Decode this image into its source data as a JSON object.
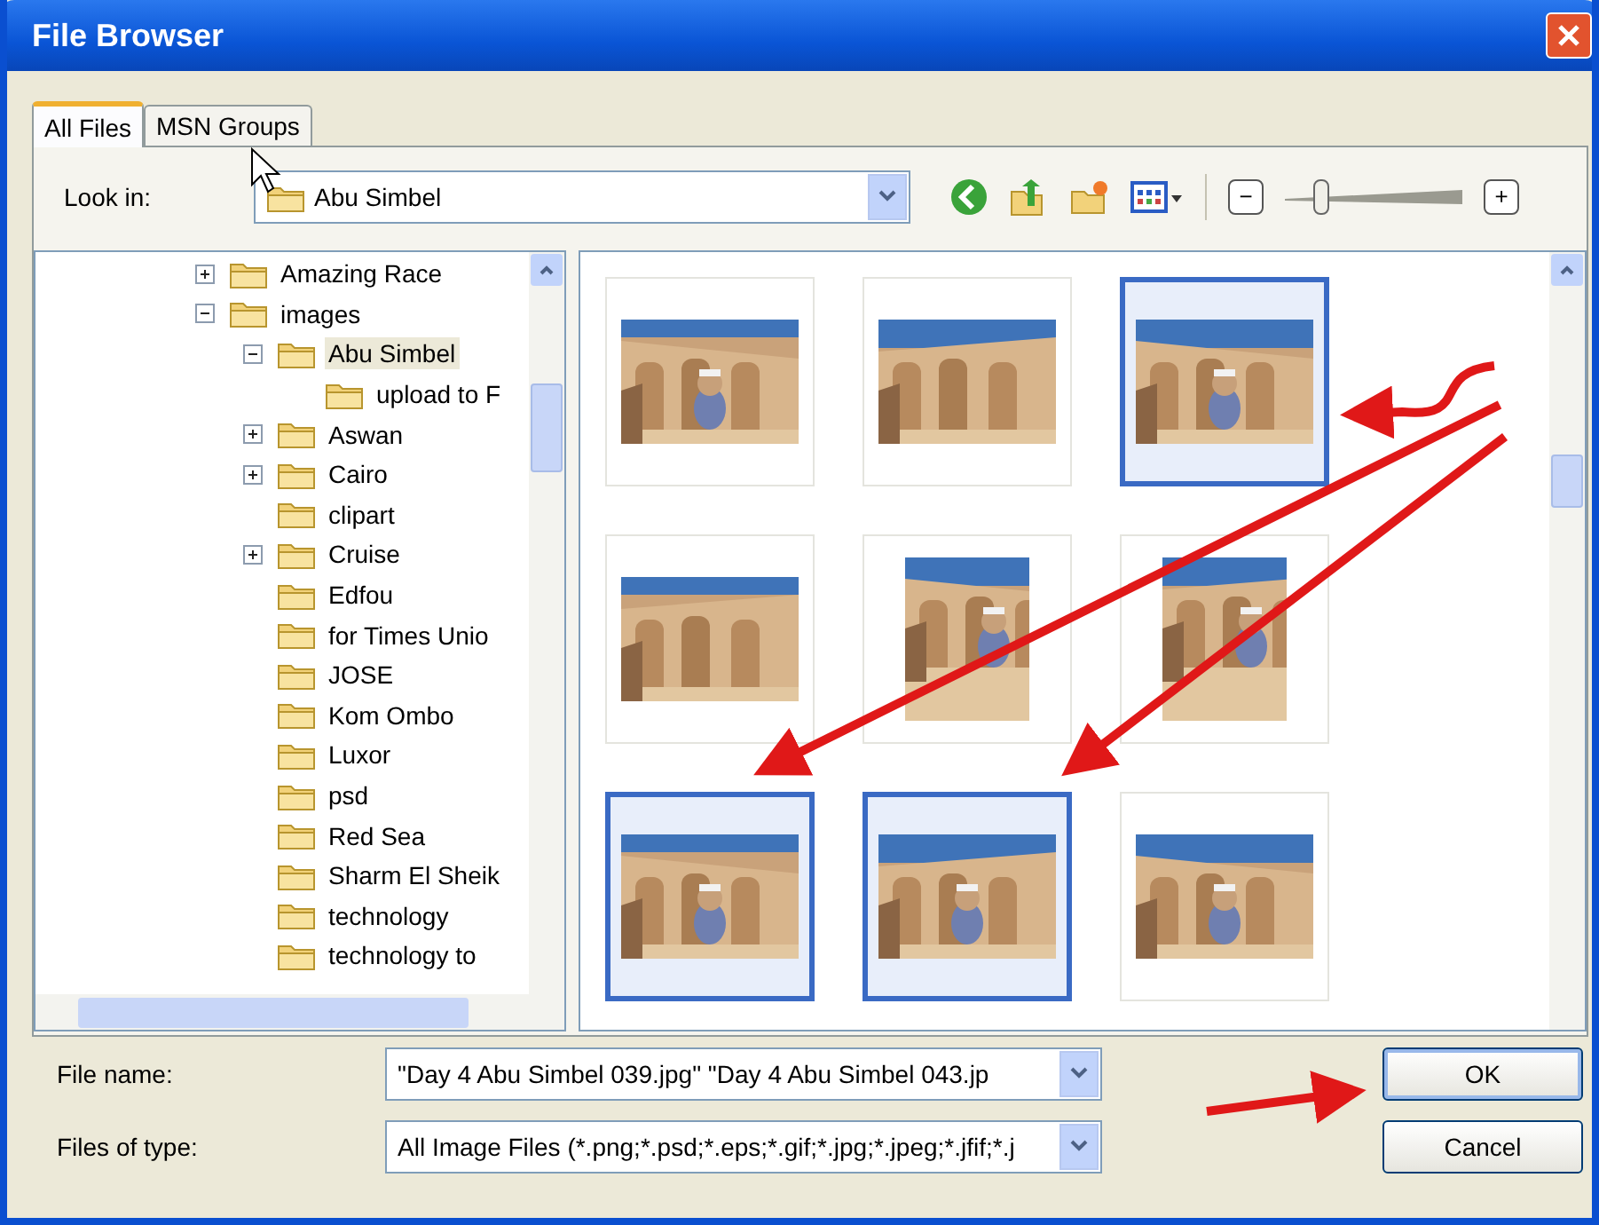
{
  "window": {
    "title": "File Browser"
  },
  "tabs": [
    {
      "label": "All Files",
      "selected": true
    },
    {
      "label": "MSN Groups",
      "selected": false
    }
  ],
  "look_in": {
    "label": "Look in:",
    "value": "Abu Simbel"
  },
  "zoom": {
    "zoom_out": "−",
    "zoom_in": "+",
    "level": 0.2
  },
  "tree": [
    {
      "label": "Amazing Race",
      "expanded": false,
      "selected": false
    },
    {
      "label": "images",
      "expanded": true,
      "selected": false,
      "children": [
        {
          "label": "Abu Simbel",
          "expanded": true,
          "selected": true,
          "children": [
            {
              "label": "upload to F",
              "selected": false
            }
          ]
        },
        {
          "label": "Aswan",
          "expanded": false,
          "selected": false
        },
        {
          "label": "Cairo",
          "expanded": false,
          "selected": false
        },
        {
          "label": "clipart",
          "selected": false
        },
        {
          "label": "Cruise",
          "expanded": false,
          "selected": false
        },
        {
          "label": "Edfou",
          "selected": false
        },
        {
          "label": "for Times Unio",
          "selected": false
        },
        {
          "label": "JOSE",
          "selected": false
        },
        {
          "label": "Kom Ombo",
          "selected": false
        },
        {
          "label": "Luxor",
          "selected": false
        },
        {
          "label": "psd",
          "selected": false
        },
        {
          "label": "Red Sea",
          "selected": false
        },
        {
          "label": "Sharm El Sheik",
          "selected": false
        },
        {
          "label": "technology",
          "selected": false
        },
        {
          "label": "technology to",
          "selected": false
        }
      ]
    }
  ],
  "thumbnails": [
    {
      "kind": "picture",
      "selected": false
    },
    {
      "kind": "picture",
      "selected": false
    },
    {
      "kind": "picture",
      "selected": true
    },
    {
      "kind": "picture",
      "selected": false
    },
    {
      "kind": "picture",
      "selected": false
    },
    {
      "kind": "picture",
      "selected": false
    },
    {
      "kind": "picture",
      "selected": true
    },
    {
      "kind": "picture",
      "selected": true
    },
    {
      "kind": "picture",
      "selected": false
    }
  ],
  "file_name": {
    "label": "File name:",
    "value": "\"Day 4 Abu Simbel 039.jpg\" \"Day 4 Abu Simbel 043.jp"
  },
  "file_type": {
    "label": "Files of type:",
    "value": "All Image Files (*.png;*.psd;*.eps;*.gif;*.jpg;*.jpeg;*.jfif;*.j"
  },
  "buttons": [
    "OK",
    "Cancel"
  ]
}
